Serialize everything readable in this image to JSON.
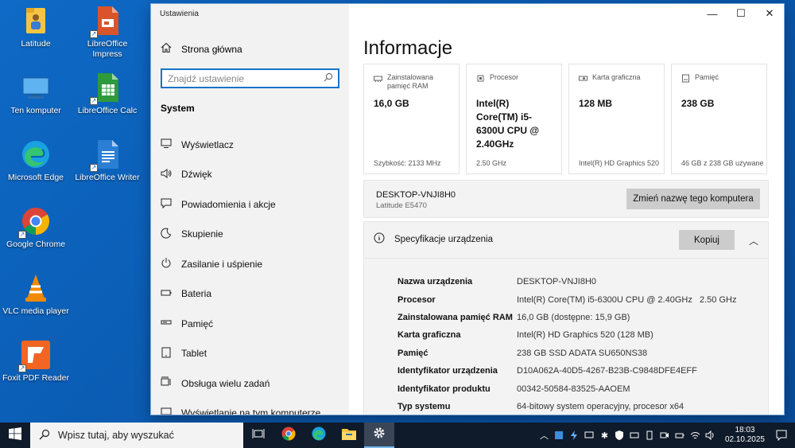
{
  "desktop": {
    "icons": [
      {
        "label": "Latitude",
        "icon": "folder-icon"
      },
      {
        "label": "LibreOffice Impress",
        "icon": "libreoffice-impress-icon"
      },
      {
        "label": "Ten komputer",
        "icon": "this-pc-icon"
      },
      {
        "label": "LibreOffice Calc",
        "icon": "libreoffice-calc-icon"
      },
      {
        "label": "Microsoft Edge",
        "icon": "edge-icon"
      },
      {
        "label": "LibreOffice Writer",
        "icon": "libreoffice-writer-icon"
      },
      {
        "label": "Google Chrome",
        "icon": "chrome-icon"
      },
      {
        "label": "VLC media player",
        "icon": "vlc-icon"
      },
      {
        "label": "Foxit PDF Reader",
        "icon": "foxit-icon"
      }
    ]
  },
  "window": {
    "title": "Ustawienia",
    "controls": {
      "minimize": "—",
      "maximize": "☐",
      "close": "✕"
    }
  },
  "sidebar": {
    "home_label": "Strona główna",
    "search_placeholder": "Znajdź ustawienie",
    "section": "System",
    "items": [
      {
        "label": "Wyświetlacz",
        "icon": "display-icon"
      },
      {
        "label": "Dźwięk",
        "icon": "sound-icon"
      },
      {
        "label": "Powiadomienia i akcje",
        "icon": "notifications-icon"
      },
      {
        "label": "Skupienie",
        "icon": "focus-icon"
      },
      {
        "label": "Zasilanie i uśpienie",
        "icon": "power-icon"
      },
      {
        "label": "Bateria",
        "icon": "battery-icon"
      },
      {
        "label": "Pamięć",
        "icon": "storage-icon"
      },
      {
        "label": "Tablet",
        "icon": "tablet-icon"
      },
      {
        "label": "Obsługa wielu zadań",
        "icon": "multitasking-icon"
      },
      {
        "label": "Wyświetlanie na tym komputerze",
        "icon": "projecting-icon"
      }
    ]
  },
  "main": {
    "title": "Informacje",
    "cards": [
      {
        "title": "Zainstalowana pamięć RAM",
        "value": "16,0 GB",
        "sub": "Szybkość: 2133 MHz",
        "icon": "ram-icon"
      },
      {
        "title": "Procesor",
        "value": "Intel(R) Core(TM) i5-6300U CPU @ 2.40GHz",
        "sub": "2.50 GHz",
        "icon": "cpu-icon"
      },
      {
        "title": "Karta graficzna",
        "value": "128 MB",
        "sub": "Intel(R) HD Graphics 520",
        "icon": "gpu-icon"
      },
      {
        "title": "Pamięć",
        "value": "238 GB",
        "sub": "46 GB z 238 GB używane",
        "icon": "storage-icon"
      }
    ],
    "pc": {
      "name": "DESKTOP-VNJI8H0",
      "model": "Latitude E5470",
      "rename_button": "Zmień nazwę tego komputera"
    },
    "specs": {
      "title": "Specyfikacje urządzenia",
      "copy_button": "Kopiuj",
      "rows": [
        {
          "key": "Nazwa urządzenia",
          "value": "DESKTOP-VNJI8H0"
        },
        {
          "key": "Procesor",
          "value": "Intel(R) Core(TM) i5-6300U CPU @ 2.40GHz   2.50 GHz"
        },
        {
          "key": "Zainstalowana pamięć RAM",
          "value": "16,0 GB (dostępne: 15,9 GB)"
        },
        {
          "key": "Karta graficzna",
          "value": "Intel(R) HD Graphics 520 (128 MB)"
        },
        {
          "key": "Pamięć",
          "value": "238 GB SSD ADATA SU650NS38"
        },
        {
          "key": "Identyfikator urządzenia",
          "value": "D10A062A-40D5-4267-B23B-C9848DFE4EFF"
        },
        {
          "key": "Identyfikator produktu",
          "value": "00342-50584-83525-AAOEM"
        },
        {
          "key": "Typ systemu",
          "value": "64-bitowy system operacyjny, procesor x64"
        }
      ]
    }
  },
  "taskbar": {
    "search_placeholder": "Wpisz tutaj, aby wyszukać",
    "apps": [
      "task-view-icon",
      "chrome-icon",
      "edge-icon",
      "file-explorer-icon",
      "settings-icon"
    ],
    "time": "18:03",
    "date": "02.10.2025"
  },
  "colors": {
    "accent": "#1a73c8",
    "desktop": "#0b5fb3",
    "taskbar": "#0f1a2a"
  }
}
